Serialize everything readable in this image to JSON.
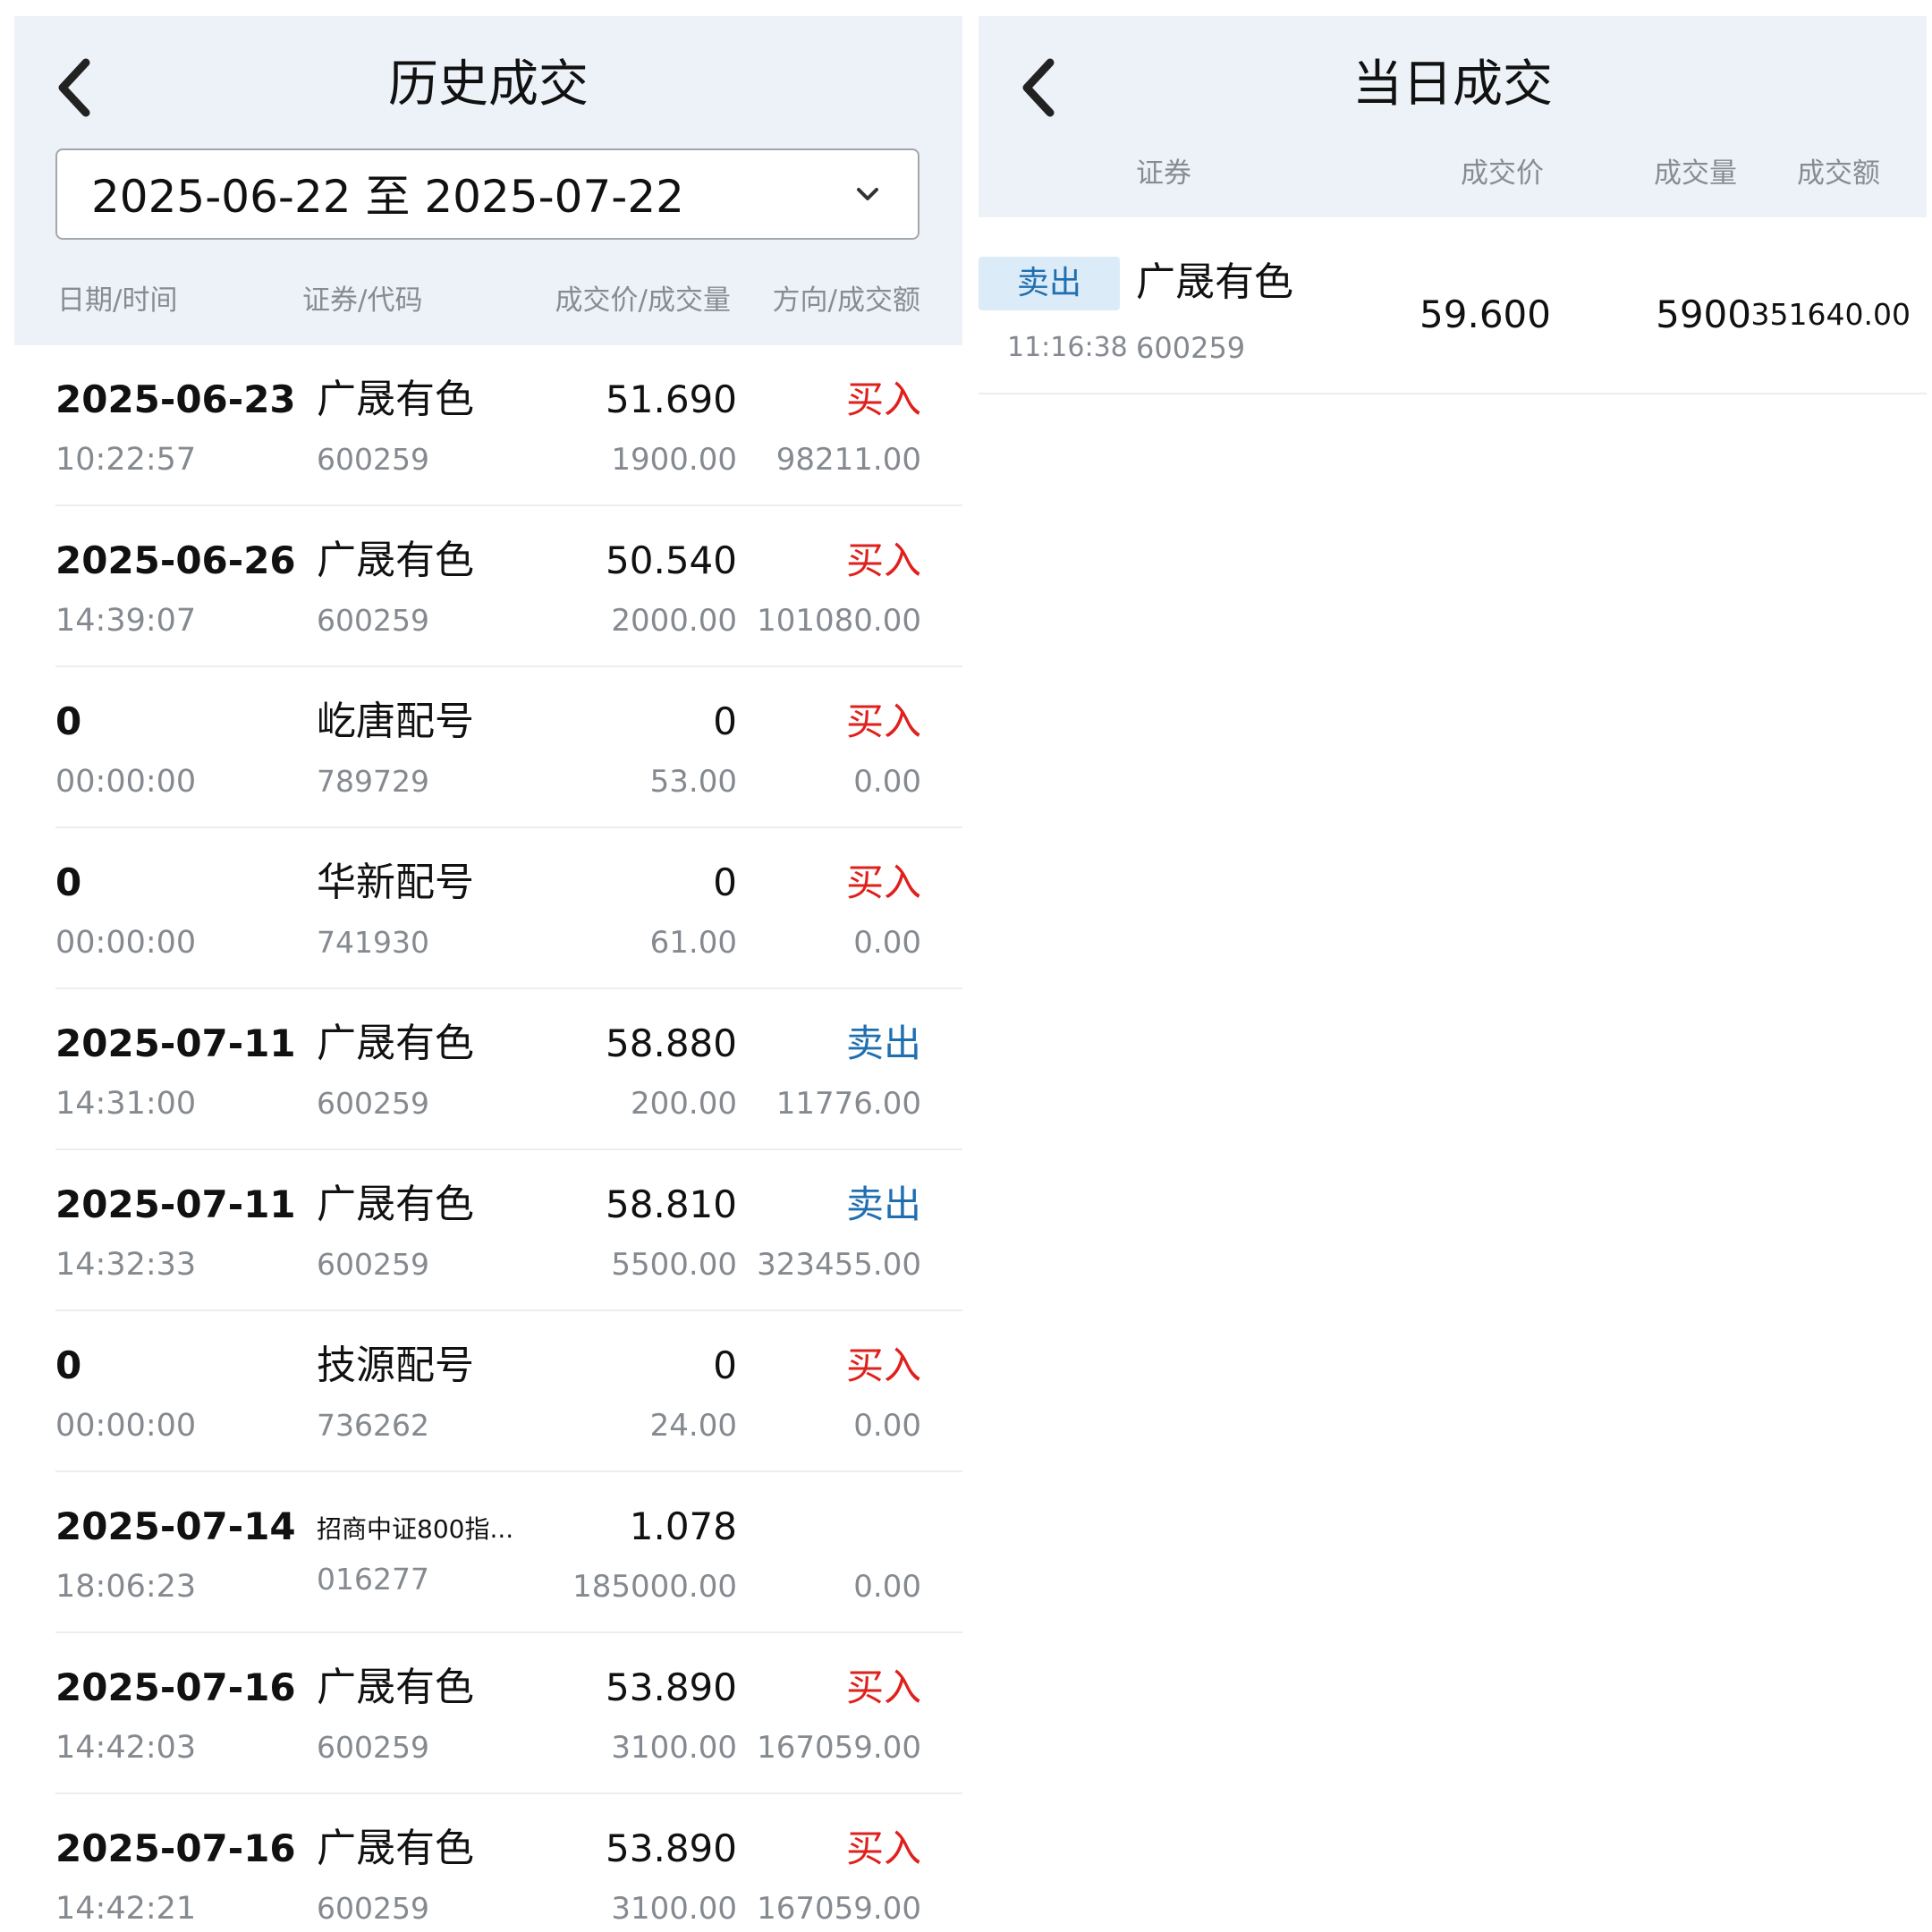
{
  "history": {
    "title": "历史成交",
    "date_range": "2025-06-22 至 2025-07-22",
    "headers": {
      "datetime": "日期/时间",
      "security": "证券/代码",
      "price_qty": "成交价/成交量",
      "dir_amount": "方向/成交额"
    },
    "rows": [
      {
        "date": "2025-06-23",
        "time": "10:22:57",
        "name": "广晟有色",
        "code": "600259",
        "price": "51.690",
        "qty": "1900.00",
        "direction": "买入",
        "amount": "98211.00"
      },
      {
        "date": "2025-06-26",
        "time": "14:39:07",
        "name": "广晟有色",
        "code": "600259",
        "price": "50.540",
        "qty": "2000.00",
        "direction": "买入",
        "amount": "101080.00"
      },
      {
        "date": "0",
        "time": "00:00:00",
        "name": "屹唐配号",
        "code": "789729",
        "price": "0",
        "qty": "53.00",
        "direction": "买入",
        "amount": "0.00"
      },
      {
        "date": "0",
        "time": "00:00:00",
        "name": "华新配号",
        "code": "741930",
        "price": "0",
        "qty": "61.00",
        "direction": "买入",
        "amount": "0.00"
      },
      {
        "date": "2025-07-11",
        "time": "14:31:00",
        "name": "广晟有色",
        "code": "600259",
        "price": "58.880",
        "qty": "200.00",
        "direction": "卖出",
        "amount": "11776.00"
      },
      {
        "date": "2025-07-11",
        "time": "14:32:33",
        "name": "广晟有色",
        "code": "600259",
        "price": "58.810",
        "qty": "5500.00",
        "direction": "卖出",
        "amount": "323455.00"
      },
      {
        "date": "0",
        "time": "00:00:00",
        "name": "技源配号",
        "code": "736262",
        "price": "0",
        "qty": "24.00",
        "direction": "买入",
        "amount": "0.00"
      },
      {
        "date": "2025-07-14",
        "time": "18:06:23",
        "name": "招商中证800指...",
        "code": "016277",
        "price": "1.078",
        "qty": "185000.00",
        "direction": "",
        "amount": "0.00"
      },
      {
        "date": "2025-07-16",
        "time": "14:42:03",
        "name": "广晟有色",
        "code": "600259",
        "price": "53.890",
        "qty": "3100.00",
        "direction": "买入",
        "amount": "167059.00"
      },
      {
        "date": "2025-07-16",
        "time": "14:42:21",
        "name": "广晟有色",
        "code": "600259",
        "price": "53.890",
        "qty": "3100.00",
        "direction": "买入",
        "amount": "167059.00"
      }
    ]
  },
  "today": {
    "title": "当日成交",
    "headers": {
      "security": "证券",
      "price": "成交价",
      "qty": "成交量",
      "amount": "成交额"
    },
    "rows": [
      {
        "badge": "卖出",
        "time": "11:16:38",
        "name": "广晟有色",
        "code": "600259",
        "price": "59.600",
        "qty": "5900",
        "amount": "351640.00"
      }
    ]
  },
  "colors": {
    "buy": "#e0201c",
    "sell": "#1f6fb0",
    "header_bg": "#edf2f8"
  },
  "icons": [
    "chevron-left-icon",
    "chevron-down-icon"
  ]
}
